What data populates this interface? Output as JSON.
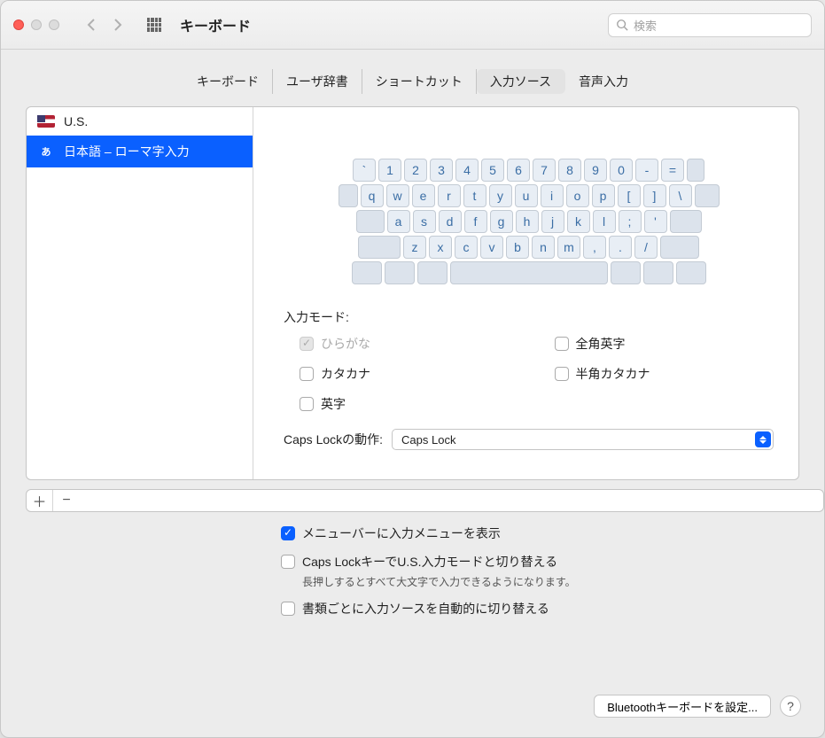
{
  "window": {
    "title": "キーボード"
  },
  "search": {
    "placeholder": "検索"
  },
  "tabs": [
    "キーボード",
    "ユーザ辞書",
    "ショートカット",
    "入力ソース",
    "音声入力"
  ],
  "active_tab_index": 3,
  "sources": [
    {
      "label": "U.S.",
      "flag": "us"
    },
    {
      "label": "日本語 – ローマ字入力",
      "flag": "jp"
    }
  ],
  "selected_source_index": 1,
  "keyboard_rows": [
    [
      "`",
      "1",
      "2",
      "3",
      "4",
      "5",
      "6",
      "7",
      "8",
      "9",
      "0",
      "-",
      "="
    ],
    [
      "q",
      "w",
      "e",
      "r",
      "t",
      "y",
      "u",
      "i",
      "o",
      "p",
      "[",
      "]",
      "\\"
    ],
    [
      "a",
      "s",
      "d",
      "f",
      "g",
      "h",
      "j",
      "k",
      "l",
      ";",
      "'"
    ],
    [
      "z",
      "x",
      "c",
      "v",
      "b",
      "n",
      "m",
      ",",
      ".",
      "/"
    ]
  ],
  "input_mode_label": "入力モード:",
  "input_modes": [
    {
      "label": "ひらがな",
      "checked": true,
      "disabled": true
    },
    {
      "label": "全角英字",
      "checked": false,
      "disabled": false
    },
    {
      "label": "カタカナ",
      "checked": false,
      "disabled": false
    },
    {
      "label": "半角カタカナ",
      "checked": false,
      "disabled": false
    },
    {
      "label": "英字",
      "checked": false,
      "disabled": false
    }
  ],
  "caps_lock": {
    "label": "Caps Lockの動作:",
    "value": "Caps Lock"
  },
  "bottom_options": [
    {
      "label": "メニューバーに入力メニューを表示",
      "checked": true
    },
    {
      "label": "Caps LockキーでU.S.入力モードと切り替える",
      "checked": false,
      "hint": "長押しするとすべて大文字で入力できるようになります。"
    },
    {
      "label": "書類ごとに入力ソースを自動的に切り替える",
      "checked": false
    }
  ],
  "footer": {
    "bluetooth_button": "Bluetoothキーボードを設定..."
  }
}
